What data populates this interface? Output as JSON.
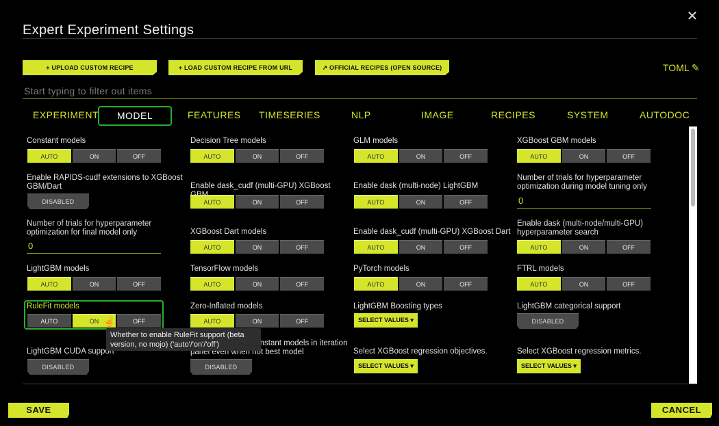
{
  "dialog": {
    "title": "Expert Experiment Settings",
    "close_icon": "close-icon"
  },
  "toolbar": {
    "upload_recipe": "+ UPLOAD CUSTOM RECIPE",
    "load_recipe_url": "+ LOAD CUSTOM RECIPE FROM URL",
    "official_recipes": "↗ OFFICIAL RECIPES (OPEN SOURCE)",
    "toml": "TOML ✎"
  },
  "filter": {
    "placeholder": "Start typing to filter out items"
  },
  "tabs": [
    "EXPERIMENT",
    "MODEL",
    "FEATURES",
    "TIMESERIES",
    "NLP",
    "IMAGE",
    "RECIPES",
    "SYSTEM",
    "AUTODOC"
  ],
  "active_tab": "MODEL",
  "tri_labels": {
    "auto": "AUTO",
    "on": "ON",
    "off": "OFF"
  },
  "disabled_label": "DISABLED",
  "select_values_label": "SELECT VALUES ▾",
  "settings": {
    "constant_models": "Constant models",
    "decision_tree_models": "Decision Tree models",
    "glm_models": "GLM models",
    "xgboost_gbm_models": "XGBoost GBM models",
    "rapids_cudf": "Enable RAPIDS-cudf extensions to XGBoost GBM/Dart",
    "dask_cudf_xgb_gbm": "Enable dask_cudf (multi-GPU) XGBoost GBM",
    "dask_lightgbm": "Enable dask (multi-node) LightGBM",
    "trials_tuning": "Number of trials for hyperparameter optimization during model tuning only",
    "trials_tuning_value": "0",
    "trials_final": "Number of trials for hyperparameter optimization for final model only",
    "trials_final_value": "0",
    "xgboost_dart_models": "XGBoost Dart models",
    "dask_cudf_xgb_dart": "Enable dask_cudf (multi-GPU) XGBoost Dart",
    "dask_hyper_search": "Enable dask (multi-node/multi-GPU) hyperparameter search",
    "lightgbm_models": "LightGBM models",
    "tensorflow_models": "TensorFlow models",
    "pytorch_models": "PyTorch models",
    "ftrl_models": "FTRL models",
    "rulefit_models": "RuleFit models",
    "zero_inflated_models": "Zero-Inflated models",
    "lightgbm_boosting_types": "LightGBM Boosting types",
    "lightgbm_categorical": "LightGBM categorical support",
    "lightgbm_cuda": "LightGBM CUDA support",
    "constant_models_iteration": "Whether to show constant models in iteration panel even when not best model",
    "xgb_reg_objectives": "Select XGBoost regression objectives.",
    "xgb_reg_metrics": "Select XGBoost regression metrics."
  },
  "tooltip": "Whether to enable RuleFit support (beta version, no mojo) ('auto'/'on'/'off')",
  "footer": {
    "save": "SAVE",
    "cancel": "CANCEL"
  }
}
